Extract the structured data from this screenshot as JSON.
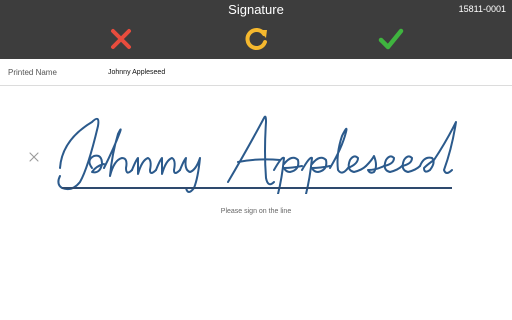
{
  "header": {
    "title": "Signature",
    "document_id": "15811-0001"
  },
  "toolbar": {
    "cancel_icon": "close-icon",
    "reset_icon": "refresh-icon",
    "confirm_icon": "check-icon",
    "colors": {
      "bar": "#3d3d3d",
      "cancel": "#e84c3d",
      "reset": "#f5b82e",
      "confirm": "#3fb43f"
    }
  },
  "form": {
    "printed_name_label": "Printed Name",
    "printed_name_value": "Johnny Appleseed"
  },
  "signature_pad": {
    "signature_text": "Johnny Appleseed",
    "hint": "Please sign on the line",
    "ink_color": "#2b5a8c"
  }
}
